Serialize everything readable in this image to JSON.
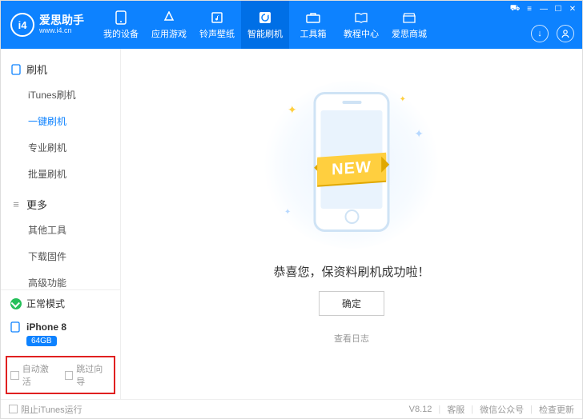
{
  "app": {
    "logo_text": "i4",
    "name": "爱思助手",
    "url": "www.i4.cn"
  },
  "nav": [
    {
      "label": "我的设备",
      "icon": "phone"
    },
    {
      "label": "应用游戏",
      "icon": "apps"
    },
    {
      "label": "铃声壁纸",
      "icon": "music"
    },
    {
      "label": "智能刷机",
      "icon": "refresh",
      "active": true
    },
    {
      "label": "工具箱",
      "icon": "toolbox"
    },
    {
      "label": "教程中心",
      "icon": "book"
    },
    {
      "label": "爱思商城",
      "icon": "store"
    }
  ],
  "sidebar": {
    "group1": {
      "title": "刷机",
      "items": [
        "iTunes刷机",
        "一键刷机",
        "专业刷机",
        "批量刷机"
      ],
      "active_index": 1
    },
    "group2": {
      "title": "更多",
      "items": [
        "其他工具",
        "下载固件",
        "高级功能"
      ]
    },
    "mode": "正常模式",
    "device": {
      "name": "iPhone 8",
      "storage": "64GB"
    },
    "checks": {
      "auto_activate": "自动激活",
      "skip_setup": "跳过向导"
    }
  },
  "main": {
    "ribbon": "NEW",
    "message": "恭喜您，保资料刷机成功啦！",
    "ok": "确定",
    "view_log": "查看日志"
  },
  "footer": {
    "block_itunes": "阻止iTunes运行",
    "version": "V8.12",
    "support": "客服",
    "wechat": "微信公众号",
    "check_update": "检查更新"
  }
}
